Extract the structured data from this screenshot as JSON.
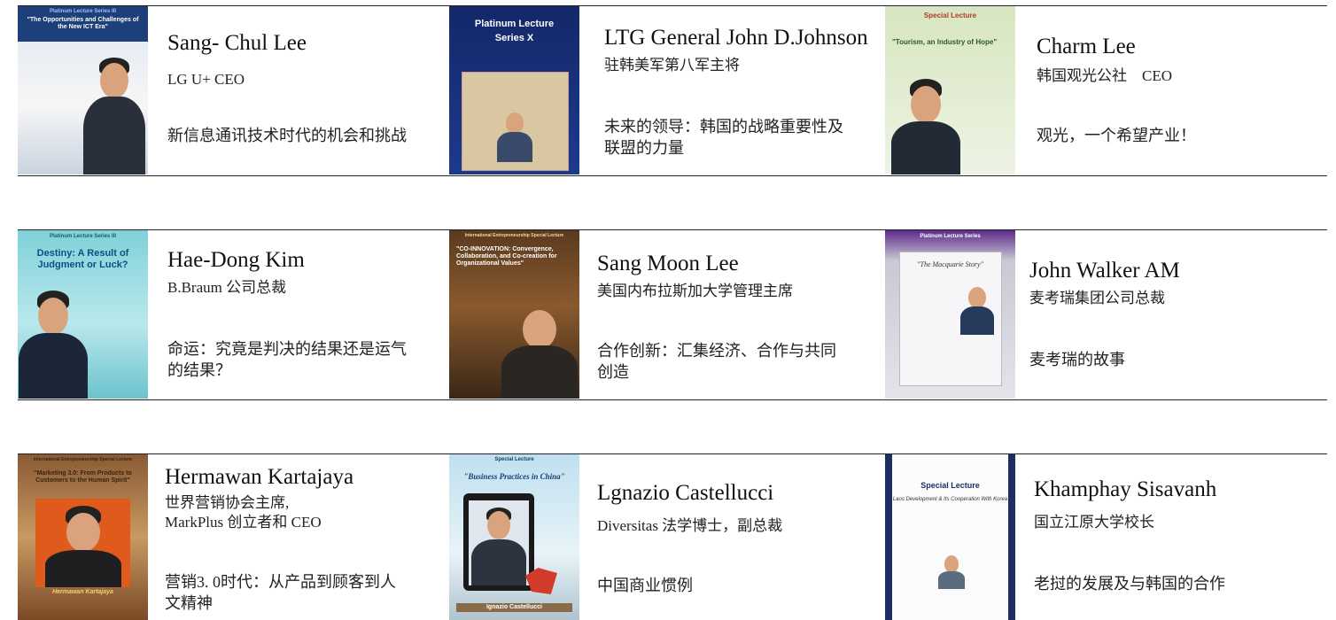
{
  "lectures": [
    {
      "name": "Sang- Chul Lee",
      "role": [
        "LG U+ CEO"
      ],
      "topic": [
        "新信息通讯技术时代的机会和挑战"
      ],
      "poster": {
        "series": "Platinum Lecture Series III",
        "title": "\"The Opportunities and Challenges of the New ICT Era\"",
        "theme": "blue-white"
      }
    },
    {
      "name": "LTG General John D.Johnson",
      "role": [
        "驻韩美军第八军主将"
      ],
      "topic": [
        "未来的领导：韩国的战略重要性及",
        "联盟的力量"
      ],
      "poster": {
        "series": "Platinum Lecture",
        "title": "Series X",
        "theme": "navy"
      }
    },
    {
      "name": "Charm Lee",
      "role": [
        "韩国观光公社　CEO"
      ],
      "topic": [
        "观光，一个希望产业！"
      ],
      "poster": {
        "series": "Special Lecture",
        "title": "\"Tourism, an Industry of Hope\"",
        "theme": "green"
      }
    },
    {
      "name": "Hae-Dong Kim",
      "role": [
        "B.Braum 公司总裁"
      ],
      "topic": [
        "命运：究竟是判决的结果还是运气",
        "的结果？"
      ],
      "poster": {
        "series": "Platinum Lecture Series III",
        "title": "Destiny: A Result of Judgment or Luck?",
        "theme": "teal"
      }
    },
    {
      "name": "Sang Moon Lee",
      "role": [
        "美国内布拉斯加大学管理主席"
      ],
      "topic": [
        "合作创新：汇集经济、合作与共同",
        "创造"
      ],
      "poster": {
        "series": "International Entrepreneurship Special Lecture",
        "title": "\"CO-INNOVATION: Convergence, Collaboration, and Co-creation for Organizational Values\"",
        "theme": "brown"
      }
    },
    {
      "name": "John Walker AM",
      "role": [
        "麦考瑞集团公司总裁"
      ],
      "topic": [
        "麦考瑞的故事"
      ],
      "poster": {
        "series": "Platinum Lecture Series",
        "title": "\"The Macquarie Story\"",
        "theme": "grey"
      }
    },
    {
      "name": "Hermawan Kartajaya",
      "role": [
        "世界营销协会主席,",
        "MarkPlus 创立者和  CEO"
      ],
      "topic": [
        "营销3. 0时代：从产品到顾客到人",
        "文精神"
      ],
      "poster": {
        "series": "International Entrepreneurship Special Lecture",
        "title": "\"Marketing 3.0: From Products to Customers to the Human Spirit\"",
        "caption": "Hermawan Kartajaya",
        "theme": "sepia"
      }
    },
    {
      "name": "Lgnazio Castellucci",
      "role": [
        "Diversitas 法学博士，副总裁"
      ],
      "topic": [
        "中国商业惯例"
      ],
      "poster": {
        "series": "Special Lecture",
        "title": "\"Business Practices in China\"",
        "caption": "Ignazio Castellucci",
        "theme": "sky"
      }
    },
    {
      "name": "Khamphay Sisavanh",
      "role": [
        "国立江原大学校长"
      ],
      "topic": [
        "老挝的发展及与韩国的合作"
      ],
      "poster": {
        "series": "Special Lecture",
        "title": "Laos Development & Its Cooperation With Korea",
        "theme": "white-navy"
      }
    }
  ]
}
